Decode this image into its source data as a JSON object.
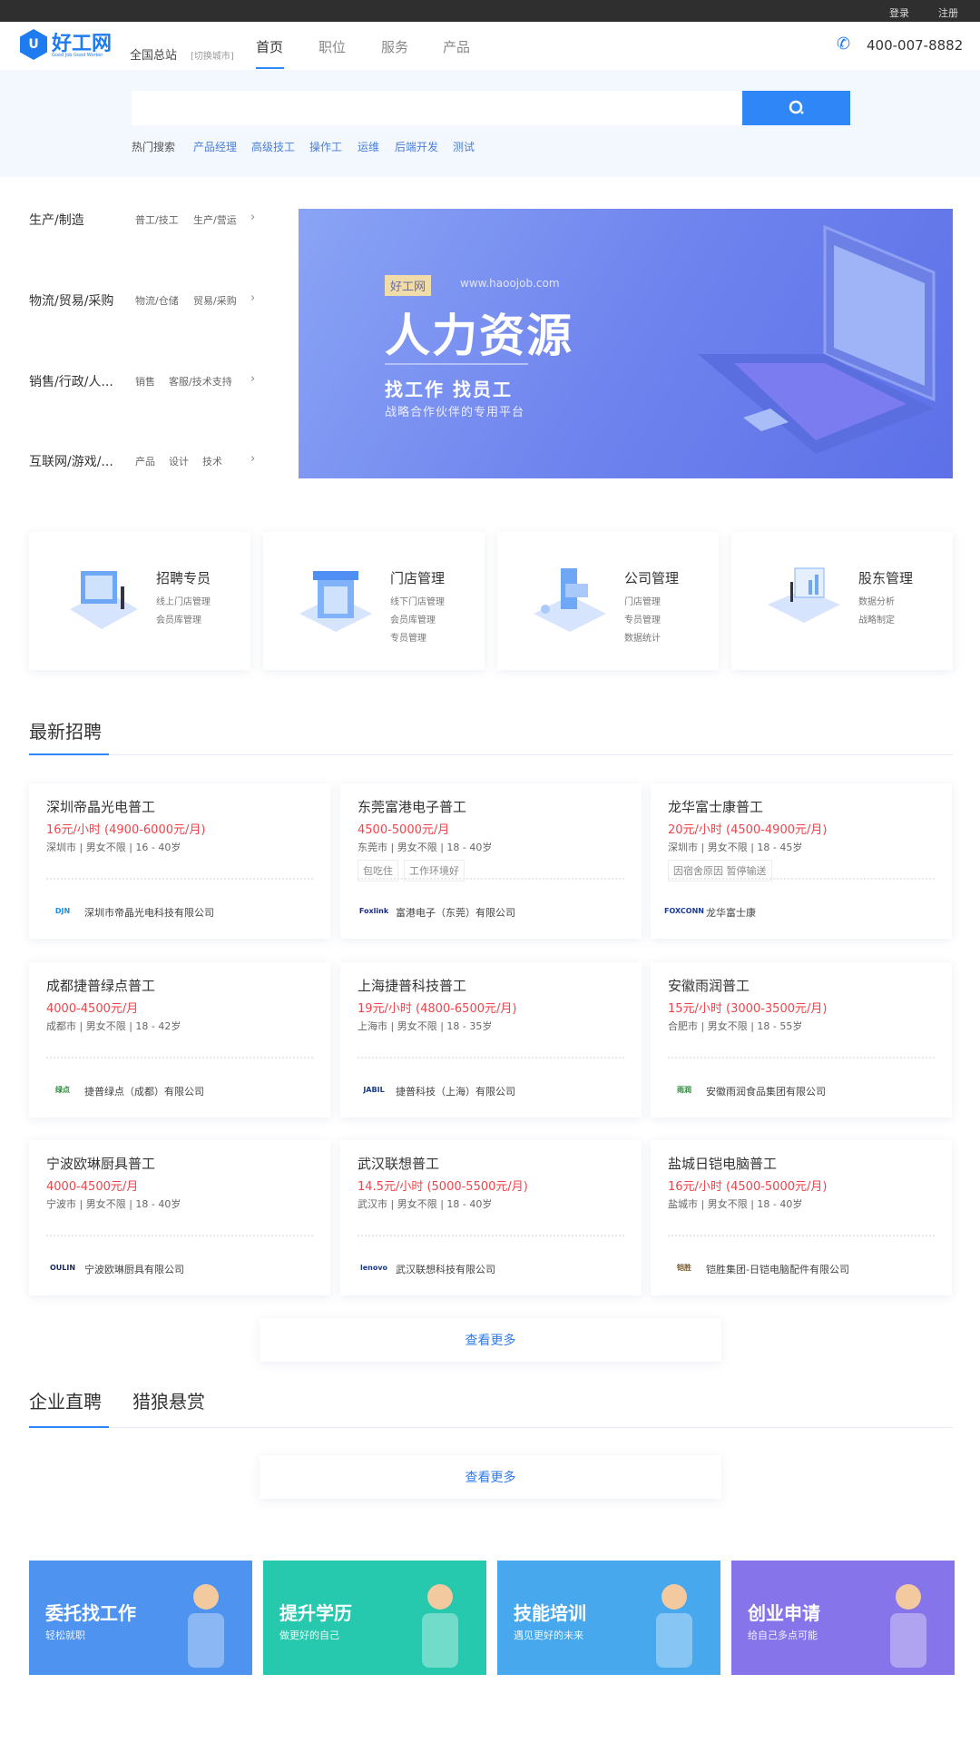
{
  "topbar": {
    "login": "登录",
    "register": "注册"
  },
  "header": {
    "logo_text": "好工网",
    "logo_sub": "Good Job Good Worker",
    "site": "全国总站",
    "switch_city": "[切换城市]",
    "nav": [
      "首页",
      "职位",
      "服务",
      "产品"
    ],
    "phone": "400-007-8882"
  },
  "search": {
    "placeholder": "",
    "hot_label": "热门搜索",
    "hot": [
      "产品经理",
      "高级技工",
      "操作工",
      "运维",
      "后端开发",
      "测试"
    ]
  },
  "categories": [
    {
      "title": "生产/制造",
      "subs": [
        "普工/技工",
        "生产/营运"
      ]
    },
    {
      "title": "物流/贸易/采购",
      "subs": [
        "物流/仓储",
        "贸易/采购"
      ]
    },
    {
      "title": "销售/行政/人...",
      "subs": [
        "销售",
        "客服/技术支持"
      ]
    },
    {
      "title": "互联网/游戏/...",
      "subs": [
        "产品",
        "设计",
        "技术"
      ]
    }
  ],
  "banner": {
    "badge": "好工网",
    "url": "www.haoojob.com",
    "title": "人力资源",
    "subtitle": "找工作 找员工",
    "tagline": "战略合作伙伴的专用平台"
  },
  "services": [
    {
      "title": "招聘专员",
      "lines": [
        "线上门店管理",
        "会员库管理"
      ]
    },
    {
      "title": "门店管理",
      "lines": [
        "线下门店管理",
        "会员库管理",
        "专员管理"
      ]
    },
    {
      "title": "公司管理",
      "lines": [
        "门店管理",
        "专员管理",
        "数据统计"
      ]
    },
    {
      "title": "股东管理",
      "lines": [
        "数据分析",
        "战略制定"
      ]
    }
  ],
  "latest": {
    "title": "最新招聘",
    "more": "查看更多",
    "jobs": [
      {
        "title": "深圳帝晶光电普工",
        "pay": "16元/小时  (4900-6000元/月)",
        "meta": "深圳市 | 男女不限 | 16 - 40岁",
        "tags": [],
        "logo": "DJN",
        "company": "深圳市帝晶光电科技有限公司",
        "logo_color": "#1a8fe0"
      },
      {
        "title": "东莞富港电子普工",
        "pay": "4500-5000元/月",
        "meta": "东莞市 | 男女不限 | 18 - 40岁",
        "tags": [
          "包吃住",
          "工作环境好"
        ],
        "logo": "Foxlink",
        "company": "富港电子（东莞）有限公司",
        "logo_color": "#1a2a8a"
      },
      {
        "title": "龙华富士康普工",
        "pay": "20元/小时  (4500-4900元/月)",
        "meta": "深圳市 | 男女不限 | 18 - 45岁",
        "tags": [
          "因宿舍原因 暂停输送"
        ],
        "logo": "FOXCONN",
        "company": "龙华富士康",
        "logo_color": "#1a3a9a"
      },
      {
        "title": "成都捷普绿点普工",
        "pay": "4000-4500元/月",
        "meta": "成都市 | 男女不限 | 18 - 42岁",
        "tags": [],
        "logo": "绿点",
        "company": "捷普绿点（成都）有限公司",
        "logo_color": "#2a8a3a"
      },
      {
        "title": "上海捷普科技普工",
        "pay": "19元/小时  (4800-6500元/月)",
        "meta": "上海市 | 男女不限 | 18 - 35岁",
        "tags": [],
        "logo": "JABIL",
        "company": "捷普科技（上海）有限公司",
        "logo_color": "#1a3a8a"
      },
      {
        "title": "安徽雨润普工",
        "pay": "15元/小时  (3000-3500元/月)",
        "meta": "合肥市 | 男女不限 | 18 - 55岁",
        "tags": [],
        "logo": "雨润",
        "company": "安徽雨润食品集团有限公司",
        "logo_color": "#2a8a3a"
      },
      {
        "title": "宁波欧琳厨具普工",
        "pay": "4000-4500元/月",
        "meta": "宁波市 | 男女不限 | 18 - 40岁",
        "tags": [],
        "logo": "OULIN",
        "company": "宁波欧琳厨具有限公司",
        "logo_color": "#1a2a5a"
      },
      {
        "title": "武汉联想普工",
        "pay": "14.5元/小时  (5000-5500元/月)",
        "meta": "武汉市 | 男女不限 | 18 - 40岁",
        "tags": [],
        "logo": "lenovo",
        "company": "武汉联想科技有限公司",
        "logo_color": "#1a3a8a"
      },
      {
        "title": "盐城日铠电脑普工",
        "pay": "16元/小时  (4500-5000元/月)",
        "meta": "盐城市 | 男女不限 | 18 - 40岁",
        "tags": [],
        "logo": "铠胜",
        "company": "铠胜集团-日铠电脑配件有限公司",
        "logo_color": "#7a5a2a"
      }
    ]
  },
  "tabs2": {
    "items": [
      "企业直聘",
      "猎狼悬赏"
    ],
    "more": "查看更多"
  },
  "bottom_banners": [
    {
      "title": "委托找工作",
      "sub": "轻松就职",
      "color": "#4e93f0"
    },
    {
      "title": "提升学历",
      "sub": "做更好的自己",
      "color": "#26c9ae"
    },
    {
      "title": "技能培训",
      "sub": "遇见更好的未来",
      "color": "#48a8ee"
    },
    {
      "title": "创业申请",
      "sub": "给自己多点可能",
      "color": "#8674ea"
    }
  ],
  "colors": {
    "accent": "#2f86f6",
    "salary": "#f2434b",
    "search_band": "#f3f7fe"
  }
}
